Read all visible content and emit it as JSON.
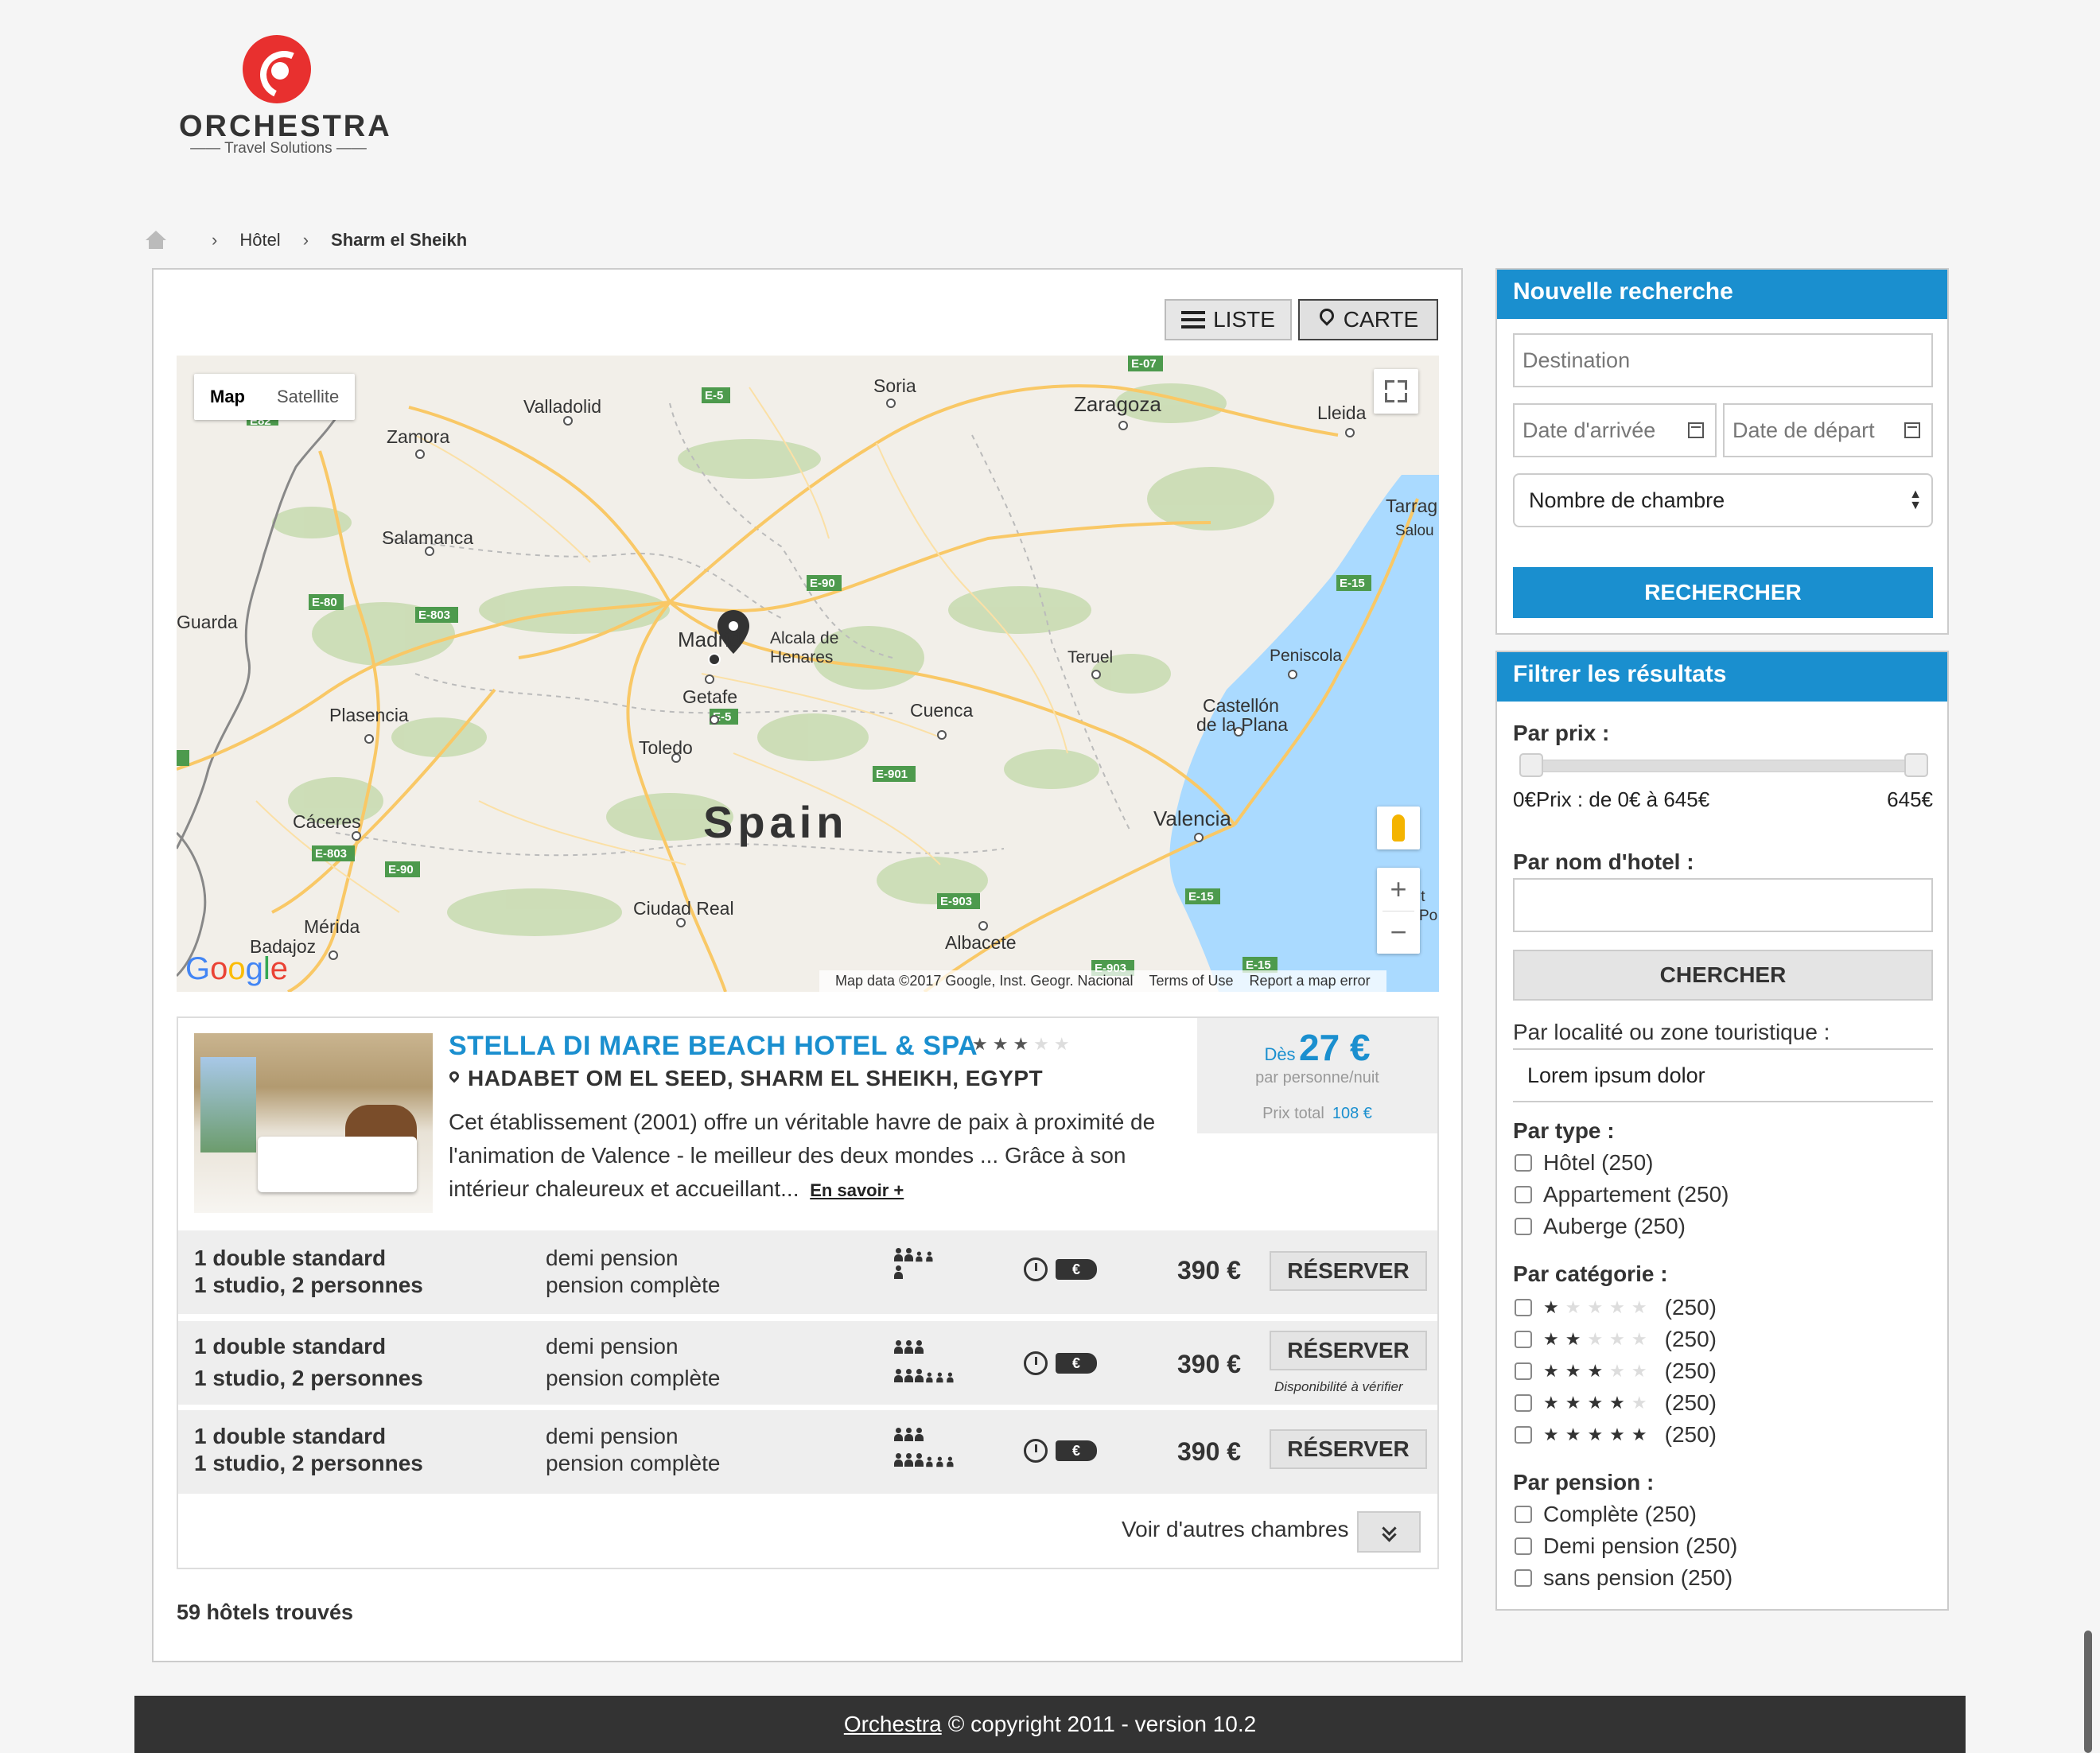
{
  "brand": {
    "name": "ORCHESTRA",
    "tagline": "Travel Solutions",
    "accent": "#1a8fcf",
    "logo_color": "#e8302f"
  },
  "breadcrumb": {
    "home_icon": "home-icon",
    "items": [
      "Hôtel",
      "Sharm el Sheikh"
    ]
  },
  "view_toggle": {
    "list_label": "LISTE",
    "map_label": "CARTE",
    "active": "CARTE"
  },
  "map": {
    "type_options": [
      "Map",
      "Satellite"
    ],
    "active_type": "Map",
    "country_label": "Spain",
    "cities": [
      "Valladolid",
      "Zamora",
      "Salamanca",
      "Soria",
      "Zaragoza",
      "Lleida",
      "Tarrag",
      "Salou",
      "Guarda",
      "Madrid",
      "Alcala de",
      "Henares",
      "Getafe",
      "Toledo",
      "Teruel",
      "Peniscola",
      "Cuenca",
      "Castellón",
      "de la Plana",
      "Plasencia",
      "Cáceres",
      "Valencia",
      "Ciudad Real",
      "Mérida",
      "Badajoz",
      "Albacete"
    ],
    "roads": [
      "E-07",
      "E-5",
      "E82",
      "E-90",
      "E-15",
      "E-80",
      "E-803",
      "E-5",
      "E-901",
      "E-803",
      "E-90",
      "E-903",
      "E-15",
      "E-903",
      "E-15"
    ],
    "zoom_in": "+",
    "zoom_out": "−",
    "footer": {
      "data": "Map data ©2017 Google, Inst. Geogr. Nacional",
      "terms": "Terms of Use",
      "report": "Report a map error"
    },
    "google": "Google"
  },
  "hotel": {
    "name": "STELLA DI MARE BEACH HOTEL & SPA",
    "stars": 3,
    "stars_max": 5,
    "location": "HADABET OM EL SEED, SHARM EL SHEIKH, EGYPT",
    "description": "Cet établissement (2001) offre un véritable havre de paix à  proximité de l'animation de Valence - le meilleur des deux mondes ... Grâce à  son intérieur chaleureux et accueillant...",
    "more_link": "En savoir +",
    "price_from_label": "Dès",
    "price_from": "27 €",
    "price_per": "par personne/nuit",
    "total_label": "Prix total",
    "total_value": "108 €",
    "rooms": [
      {
        "type_line1": "1 double standard",
        "type_line2": "1 studio, 2 personnes",
        "board_line1": "demi pension",
        "board_line2": "pension complète",
        "price": "390 €",
        "button": "RÉSERVER",
        "note": ""
      },
      {
        "type_line1": "1 double standard",
        "type_line2": "1 studio, 2 personnes",
        "board_line1": "demi pension",
        "board_line2": "pension complète",
        "price": "390 €",
        "button": "RÉSERVER",
        "note": "Disponibilité à vérifier"
      },
      {
        "type_line1": "1 double standard",
        "type_line2": "1 studio, 2 personnes",
        "board_line1": "demi pension",
        "board_line2": "pension complète",
        "price": "390 €",
        "button": "RÉSERVER",
        "note": ""
      }
    ],
    "tag_symbol": "€",
    "more_rooms": "Voir d'autres chambres"
  },
  "results_count": "59 hôtels trouvés",
  "search": {
    "title": "Nouvelle recherche",
    "destination_placeholder": "Destination",
    "arrival_placeholder": "Date d'arrivée",
    "departure_placeholder": "Date de départ",
    "rooms_select": "Nombre de chambre",
    "submit": "RECHERCHER"
  },
  "filter": {
    "title": "Filtrer les résultats",
    "price_label": "Par prix :",
    "price_min": "0€",
    "price_text": "Prix : de 0€ à 645€",
    "price_max": "645€",
    "price_range_fraction": [
      0,
      1
    ],
    "hotel_name_label": "Par nom d'hotel :",
    "hotel_name_value": "",
    "search_btn": "CHERCHER",
    "locality_label": "Par localité ou zone touristique :",
    "locality_value": "Lorem ipsum dolor",
    "type_label": "Par type :",
    "types": [
      "Hôtel (250)",
      "Appartement (250)",
      "Auberge (250)"
    ],
    "category_label": "Par catégorie :",
    "categories": [
      {
        "stars": 1,
        "count": "(250)"
      },
      {
        "stars": 2,
        "count": "(250)"
      },
      {
        "stars": 3,
        "count": "(250)"
      },
      {
        "stars": 4,
        "count": "(250)"
      },
      {
        "stars": 5,
        "count": "(250)"
      }
    ],
    "pension_label": "Par pension :",
    "pensions": [
      "Complète (250)",
      "Demi pension (250)",
      "sans pension (250)"
    ]
  },
  "footer": {
    "brand": "Orchestra",
    "text": "© copyright 2011 - version 10.2"
  }
}
